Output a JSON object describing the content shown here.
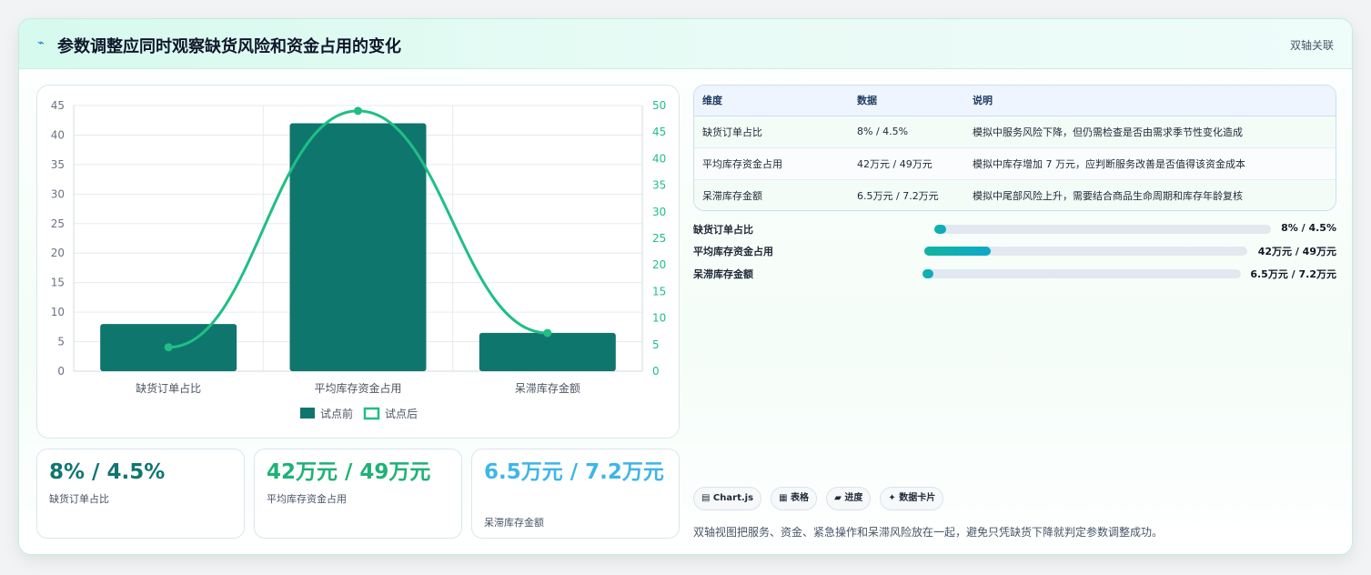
{
  "header": {
    "icon": "lightning-icon",
    "title": "参数调整应同时观察缺货风险和资金占用的变化",
    "tag": "双轴关联"
  },
  "chart_data": {
    "type": "bar",
    "categories": [
      "缺货订单占比",
      "平均库存资金占用",
      "呆滞库存金额"
    ],
    "series": [
      {
        "name": "试点前",
        "type": "bar",
        "axis": "left",
        "color": "#0f766e",
        "values": [
          8,
          42,
          6.5
        ]
      },
      {
        "name": "试点后",
        "type": "line",
        "axis": "right",
        "color": "#1fbf84",
        "values": [
          4.5,
          49,
          7.2
        ]
      }
    ],
    "y_left": {
      "min": 0,
      "max": 45,
      "ticks": [
        0,
        5,
        10,
        15,
        20,
        25,
        30,
        35,
        40,
        45
      ]
    },
    "y_right": {
      "min": 0,
      "max": 50,
      "ticks": [
        0,
        5,
        10,
        15,
        20,
        25,
        30,
        35,
        40,
        45,
        50
      ]
    },
    "grid": true,
    "legend": "bottom"
  },
  "metrics": [
    {
      "value": "8% / 4.5%",
      "label": "缺货订单占比",
      "color": "#0f766e"
    },
    {
      "value": "42万元 / 49万元",
      "label": "平均库存资金占用",
      "color": "#1fb277"
    },
    {
      "value": "6.5万元 / 7.2万元",
      "label": "呆滞库存金额",
      "color": "#3fb5e8"
    }
  ],
  "table": {
    "headers": [
      "维度",
      "数据",
      "说明"
    ],
    "rows": [
      [
        "缺货订单占比",
        "8% / 4.5%",
        "模拟中服务风险下降，但仍需检查是否由需求季节性变化造成"
      ],
      [
        "平均库存资金占用",
        "42万元 / 49万元",
        "模拟中库存增加 7 万元，应判断服务改善是否值得该资金成本"
      ],
      [
        "呆滞库存金额",
        "6.5万元 / 7.2万元",
        "模拟中尾部风险上升，需要结合商品生命周期和库存年龄复核"
      ]
    ]
  },
  "progress": [
    {
      "label": "缺货订单占比",
      "value": "8% / 4.5%",
      "fill_pct": 3.5
    },
    {
      "label": "平均库存资金占用",
      "value": "42万元 / 49万元",
      "fill_pct": 20.5
    },
    {
      "label": "呆滞库存金额",
      "value": "6.5万元 / 7.2万元",
      "fill_pct": 3.5
    }
  ],
  "chips": [
    {
      "icon": "chart-icon",
      "label": "▤ Chart.js"
    },
    {
      "icon": "table-icon",
      "label": "▦ 表格"
    },
    {
      "icon": "progress-icon",
      "label": "▰ 进度"
    },
    {
      "icon": "card-icon",
      "label": "✦ 数据卡片"
    }
  ],
  "footnote": "双轴视图把服务、资金、紧急操作和呆滞风险放在一起，避免只凭缺货下降就判定参数调整成功。"
}
